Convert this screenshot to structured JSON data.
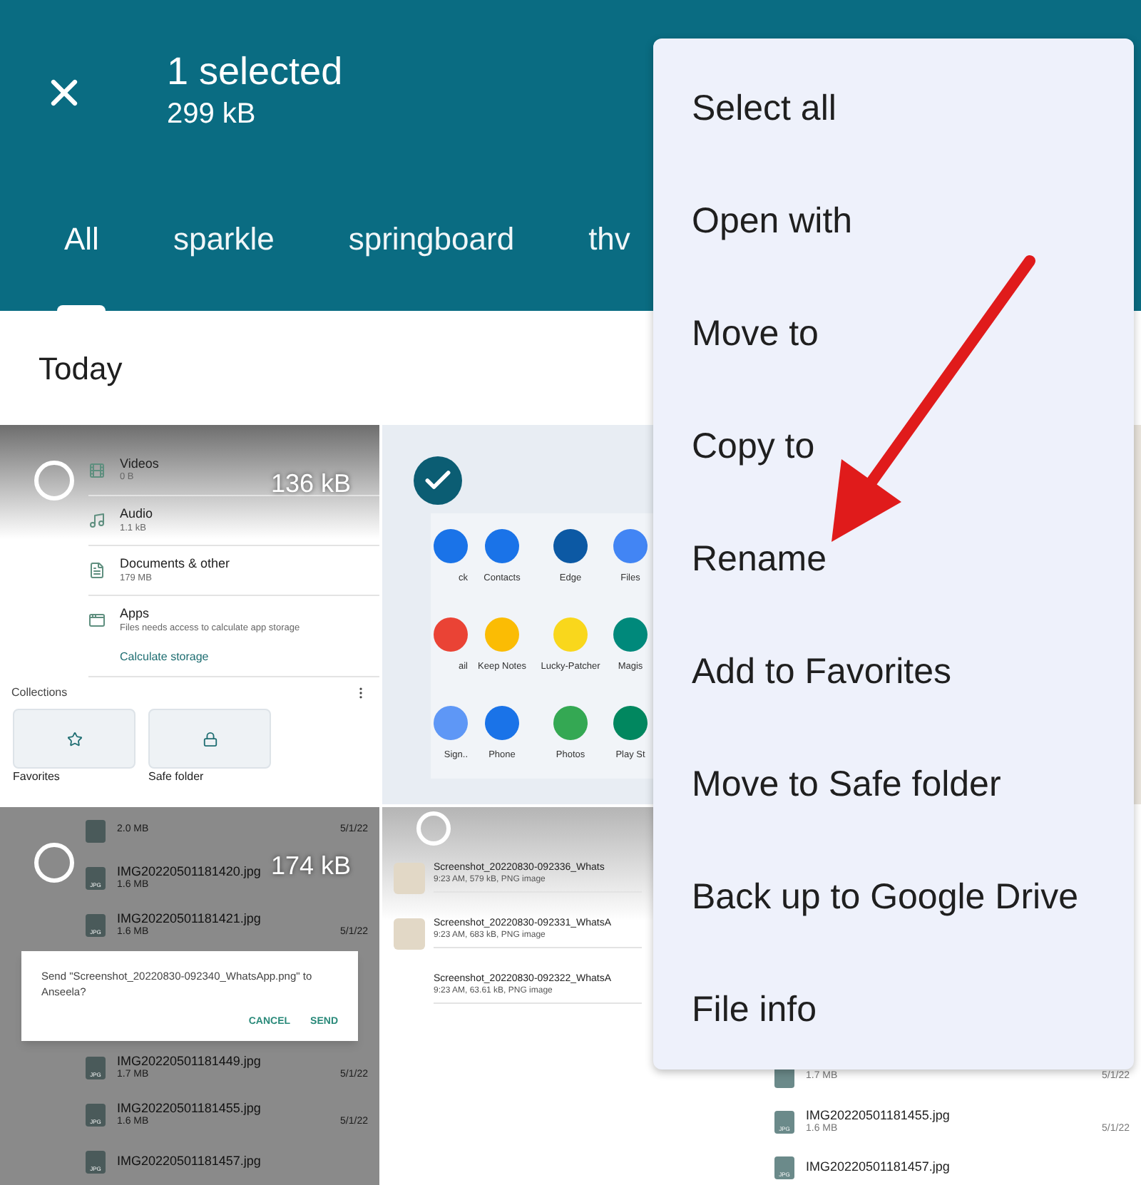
{
  "header": {
    "title": "1 selected",
    "subtitle": "299 kB"
  },
  "tabs": [
    {
      "label": "All",
      "selected": true
    },
    {
      "label": "sparkle",
      "selected": false
    },
    {
      "label": "springboard",
      "selected": false
    },
    {
      "label": "thv",
      "selected": false
    }
  ],
  "section": "Today",
  "tiles": [
    {
      "kind": "storage",
      "selected": false,
      "size": "136 kB",
      "items": [
        {
          "name": "Videos",
          "detail": "0 B"
        },
        {
          "name": "Audio",
          "detail": "1.1 kB"
        },
        {
          "name": "Documents & other",
          "detail": "179 MB"
        },
        {
          "name": "Apps",
          "detail": "Files needs access to calculate app storage"
        }
      ],
      "link": "Calculate storage",
      "collections": "Collections",
      "cards": [
        {
          "label": "Favorites"
        },
        {
          "label": "Safe folder"
        }
      ]
    },
    {
      "kind": "apps",
      "selected": true,
      "apps": [
        {
          "label": "ck",
          "color": "#1a73e8"
        },
        {
          "label": "Contacts",
          "color": "#1a73e8"
        },
        {
          "label": "Edge",
          "color": "#0c59a4"
        },
        {
          "label": "Files",
          "color": "#4285f4"
        },
        {
          "label": "ail",
          "color": "#ea4335"
        },
        {
          "label": "Keep Notes",
          "color": "#fbbc04"
        },
        {
          "label": "Lucky-Patcher",
          "color": "#f9d71c"
        },
        {
          "label": "Magis",
          "color": "#00897b"
        },
        {
          "label": "Sign..",
          "color": "#5e97f6"
        },
        {
          "label": "Phone",
          "color": "#1a73e8"
        },
        {
          "label": "Photos",
          "color": "#34a853"
        },
        {
          "label": "Play St",
          "color": "#01875f"
        }
      ]
    },
    {
      "kind": "photo"
    },
    {
      "kind": "files",
      "selected": false,
      "size": "174 kB",
      "rows_above": [
        {
          "size": "2.0 MB",
          "date": "5/1/22"
        },
        {
          "type": "JPG",
          "name": "IMG20220501181420.jpg",
          "size": "1.6 MB"
        },
        {
          "type": "JPG",
          "name": "IMG20220501181421.jpg",
          "size": "1.6 MB",
          "date": "5/1/22"
        }
      ],
      "dialog": {
        "text": "Send \"Screenshot_20220830-092340_WhatsApp.png\" to Anseela?",
        "buttons": [
          "CANCEL",
          "SEND"
        ]
      },
      "rows_below": [
        {
          "type": "JPG",
          "name": "IMG20220501181449.jpg",
          "size": "1.7 MB",
          "date": "5/1/22"
        },
        {
          "type": "JPG",
          "name": "IMG20220501181455.jpg",
          "size": "1.6 MB",
          "date": "5/1/22"
        },
        {
          "type": "JPG",
          "name": "IMG20220501181457.jpg"
        }
      ]
    },
    {
      "kind": "screenshots",
      "selected": false,
      "rows": [
        {
          "name": "Screenshot_20220830-092336_Whats",
          "detail": "9:23 AM, 579 kB, PNG image",
          "thumbnail": true
        },
        {
          "name": "Screenshot_20220830-092331_WhatsA",
          "detail": "9:23 AM, 683 kB, PNG image",
          "thumbnail": true
        },
        {
          "name": "Screenshot_20220830-092322_WhatsA",
          "detail": "9:23 AM, 63.61 kB, PNG image",
          "thumbnail": false
        }
      ]
    },
    {
      "kind": "files",
      "rows_below": [
        {
          "size": "1.7 MB",
          "date": "5/1/22"
        },
        {
          "type": "JPG",
          "name": "IMG20220501181455.jpg",
          "size": "1.6 MB",
          "date": "5/1/22"
        },
        {
          "type": "JPG",
          "name": "IMG20220501181457.jpg"
        }
      ]
    }
  ],
  "menu": [
    "Select all",
    "Open with",
    "Move to",
    "Copy to",
    "Rename",
    "Add to Favorites",
    "Move to Safe folder",
    "Back up to Google Drive",
    "File info"
  ]
}
